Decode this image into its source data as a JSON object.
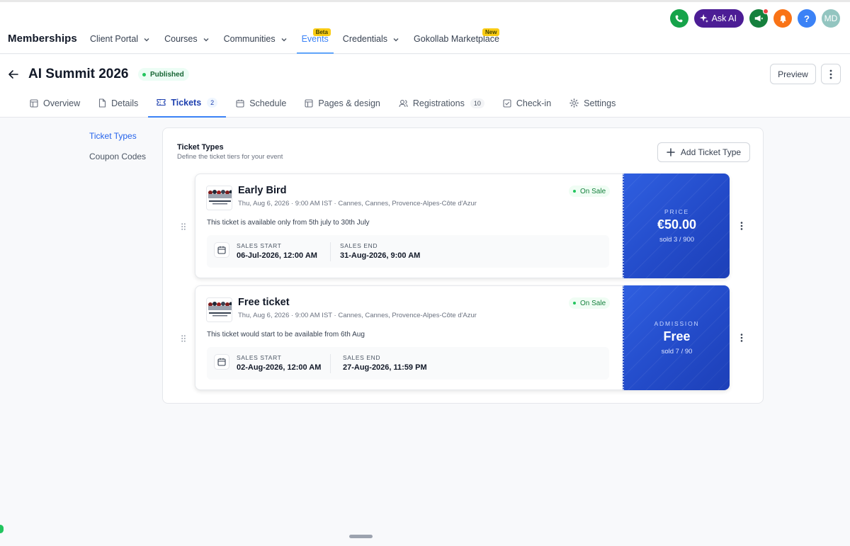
{
  "app": {
    "brand": "Memberships",
    "nav": [
      {
        "label": "Client Portal",
        "dropdown": true
      },
      {
        "label": "Courses",
        "dropdown": true
      },
      {
        "label": "Communities",
        "dropdown": true
      },
      {
        "label": "Events",
        "badge": "Beta",
        "active": true
      },
      {
        "label": "Credentials",
        "dropdown": true
      },
      {
        "label": "Gokollab Marketplace",
        "badge": "New"
      }
    ],
    "ask_ai": "Ask AI",
    "help_glyph": "?",
    "avatar_initials": "MD"
  },
  "event": {
    "title": "AI Summit 2026",
    "status": "Published",
    "preview": "Preview",
    "tabs": [
      {
        "label": "Overview",
        "icon": "layout-icon"
      },
      {
        "label": "Details",
        "icon": "file-icon"
      },
      {
        "label": "Tickets",
        "icon": "ticket-icon",
        "count": "2",
        "active": true
      },
      {
        "label": "Schedule",
        "icon": "calendar-icon"
      },
      {
        "label": "Pages & design",
        "icon": "layout-icon"
      },
      {
        "label": "Registrations",
        "icon": "users-icon",
        "count": "10"
      },
      {
        "label": "Check-in",
        "icon": "checkbox-icon"
      },
      {
        "label": "Settings",
        "icon": "gear-icon"
      }
    ]
  },
  "side": {
    "items": [
      {
        "label": "Ticket Types",
        "active": true
      },
      {
        "label": "Coupon Codes"
      }
    ]
  },
  "panel": {
    "title": "Ticket Types",
    "subtitle": "Define the ticket tiers for your event",
    "add_label": "Add Ticket Type",
    "tickets": [
      {
        "name": "Early Bird",
        "meta": "Thu, Aug 6, 2026 · 9:00 AM IST · Cannes, Cannes, Provence-Alpes-Côte d'Azur",
        "status": "On Sale",
        "description": "This ticket is available only from 5th july to 30th July",
        "sales_start_label": "SALES START",
        "sales_start": "06-Jul-2026, 12:00 AM",
        "sales_end_label": "SALES END",
        "sales_end": "31-Aug-2026, 9:00 AM",
        "stub_label": "PRICE",
        "stub_value": "€50.00",
        "stub_sold": "sold 3 / 900"
      },
      {
        "name": "Free ticket",
        "meta": "Thu, Aug 6, 2026 · 9:00 AM IST · Cannes, Cannes, Provence-Alpes-Côte d'Azur",
        "status": "On Sale",
        "description": "This ticket would start to be available from 6th Aug",
        "sales_start_label": "SALES START",
        "sales_start": "02-Aug-2026, 12:00 AM",
        "sales_end_label": "SALES END",
        "sales_end": "27-Aug-2026, 11:59 PM",
        "stub_label": "ADMISSION",
        "stub_value": "Free",
        "stub_sold": "sold 7 / 90"
      }
    ]
  },
  "colors": {
    "accent": "#3b82f6",
    "stub_blue": "#234bc9",
    "success": "#22c55e",
    "phone": "#16a34a",
    "megaphone": "#15803d",
    "bell": "#f97316",
    "help": "#3b82f6",
    "avatar": "#93c5c0",
    "ask_ai": "#4c1d95"
  }
}
